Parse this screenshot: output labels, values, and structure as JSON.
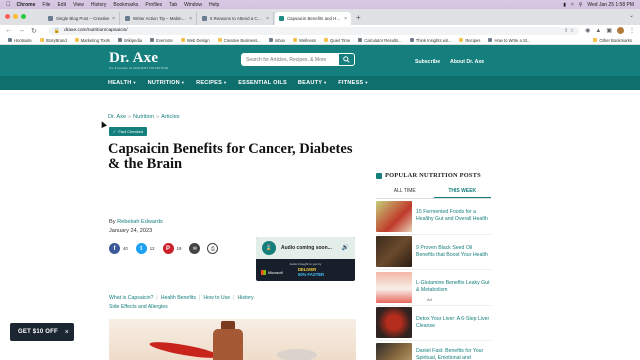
{
  "menubar": {
    "items": [
      "Chrome",
      "File",
      "Edit",
      "View",
      "History",
      "Bookmarks",
      "Profiles",
      "Tab",
      "Window",
      "Help"
    ],
    "clock": "Wed Jan 25  1:58 PM"
  },
  "tabs": [
    {
      "label": "Single Blog Post – Creative"
    },
    {
      "label": "Writer Action Tip – Making yo"
    },
    {
      "label": "5 Reasons to Attend a Contrib"
    },
    {
      "label": "Capsaicin Benefits and How to"
    }
  ],
  "toolbar": {
    "url": "draxe.com/nutrition/capsaicin/"
  },
  "bookmarks": {
    "items": [
      "Hootsuite",
      "StoryBrand",
      "Marketing Tools",
      "Wikipedia",
      "Evernote",
      "Web Design",
      "Creative Business...",
      "Inbox",
      "Wellness",
      "Quiet Time",
      "Calculator Results...",
      "Think Insights wit...",
      "Recipes",
      "How to Write a St..."
    ],
    "other": "Other Bookmarks"
  },
  "site": {
    "logo": "Dr. Axe",
    "logo_tag": "Co-Founder of ANCIENT NUTRITION",
    "search_placeholder": "Search for Articles, Recipes, & More",
    "subscribe": "Subscribe",
    "about": "About Dr. Axe",
    "nav": [
      "HEALTH",
      "NUTRITION",
      "RECIPES",
      "ESSENTIAL OILS",
      "BEAUTY",
      "FITNESS"
    ]
  },
  "article": {
    "breadcrumb": [
      "Dr. Axe",
      "Nutrition",
      "Articles"
    ],
    "fact_checked": "Fact Checked",
    "title": "Capsaicin Benefits for Cancer, Diabetes & the Brain",
    "by": "By",
    "author": "Rebekah Edwards",
    "date": "January 24, 2023",
    "shares": {
      "facebook": "40",
      "twitter": "12",
      "pinterest": "19"
    },
    "toc": [
      "What is Capsaicin?",
      "Health Benefits",
      "How to Use",
      "History",
      "Side Effects and Allergies"
    ]
  },
  "audio": {
    "coming_soon": "Audio coming soon...",
    "brought_by": "Audio brought to you by",
    "sponsor": "Microsoft",
    "deliver": "DELIVER",
    "faster": "50% FASTER"
  },
  "popular": {
    "title": "POPULAR NUTRITION POSTS",
    "tabs": [
      "ALL TIME",
      "THIS WEEK"
    ],
    "items": [
      {
        "title": "15 Fermented Foods for a Healthy Gut and Overall Health"
      },
      {
        "title": "9 Proven Black Seed Oil Benefits that Boost Your Health"
      },
      {
        "title": "L-Glutamine Benefits Leaky Gut & Metabolism"
      },
      {
        "title": "Detox Your Liver: A 6-Step Liver Cleanse"
      },
      {
        "title": "Daniel Fast: Benefits for Your Spiritual, Emotional and Physical Health"
      }
    ]
  },
  "ad_label": "Ad",
  "promo": "GET $10 OFF",
  "colors": {
    "brand": "#157f7d",
    "nav": "#0f6f6d",
    "promo": "#1c2633"
  }
}
